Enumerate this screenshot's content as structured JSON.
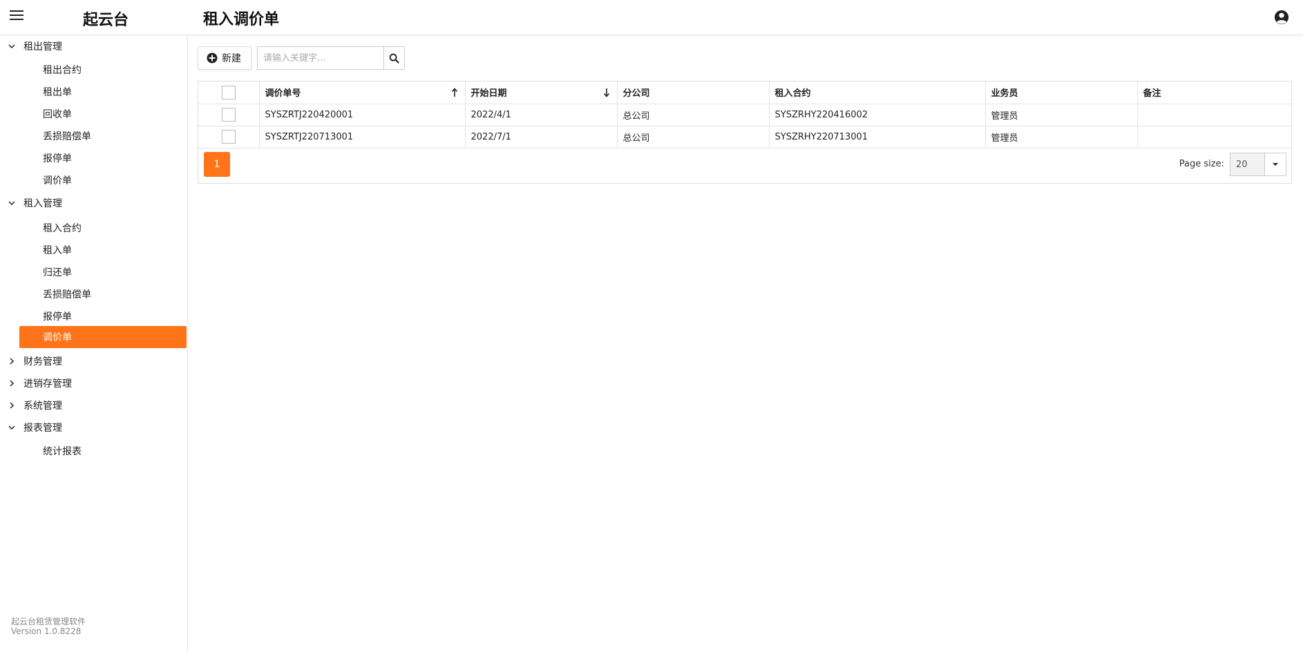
{
  "app": {
    "brand": "起云台",
    "page_title": "租入调价单"
  },
  "sidebar": {
    "groups": [
      {
        "label": "租出管理",
        "expanded": true,
        "items": [
          "租出合约",
          "租出单",
          "回收单",
          "丢损赔偿单",
          "报停单",
          "调价单"
        ]
      },
      {
        "label": "租入管理",
        "expanded": true,
        "items": [
          "租入合约",
          "租入单",
          "归还单",
          "丢损赔偿单",
          "报停单",
          "调价单"
        ]
      },
      {
        "label": "财务管理",
        "expanded": false,
        "items": []
      },
      {
        "label": "进销存管理",
        "expanded": false,
        "items": []
      },
      {
        "label": "系统管理",
        "expanded": false,
        "items": []
      },
      {
        "label": "报表管理",
        "expanded": true,
        "items": [
          "统计报表"
        ]
      }
    ],
    "active_item": "租入管理 / 调价单",
    "footer": {
      "line1": "起云台租赁管理软件",
      "line2": "Version 1.0.8228"
    }
  },
  "toolbar": {
    "new_label": "新建",
    "search_placeholder": "请输入关键字..."
  },
  "table": {
    "columns": [
      "调价单号",
      "开始日期",
      "分公司",
      "租入合约",
      "业务员",
      "备注"
    ],
    "rows": [
      [
        "SYSZRTJ220420001",
        "2022/4/1",
        "总公司",
        "SYSZRHY220416002",
        "管理员",
        ""
      ],
      [
        "SYSZRTJ220713001",
        "2022/7/1",
        "总公司",
        "SYSZRHY220713001",
        "管理员",
        ""
      ]
    ]
  },
  "pager": {
    "current_page": "1",
    "page_size_label": "Page size:",
    "page_size": "20"
  },
  "colors": {
    "accent": "#ff7418"
  }
}
